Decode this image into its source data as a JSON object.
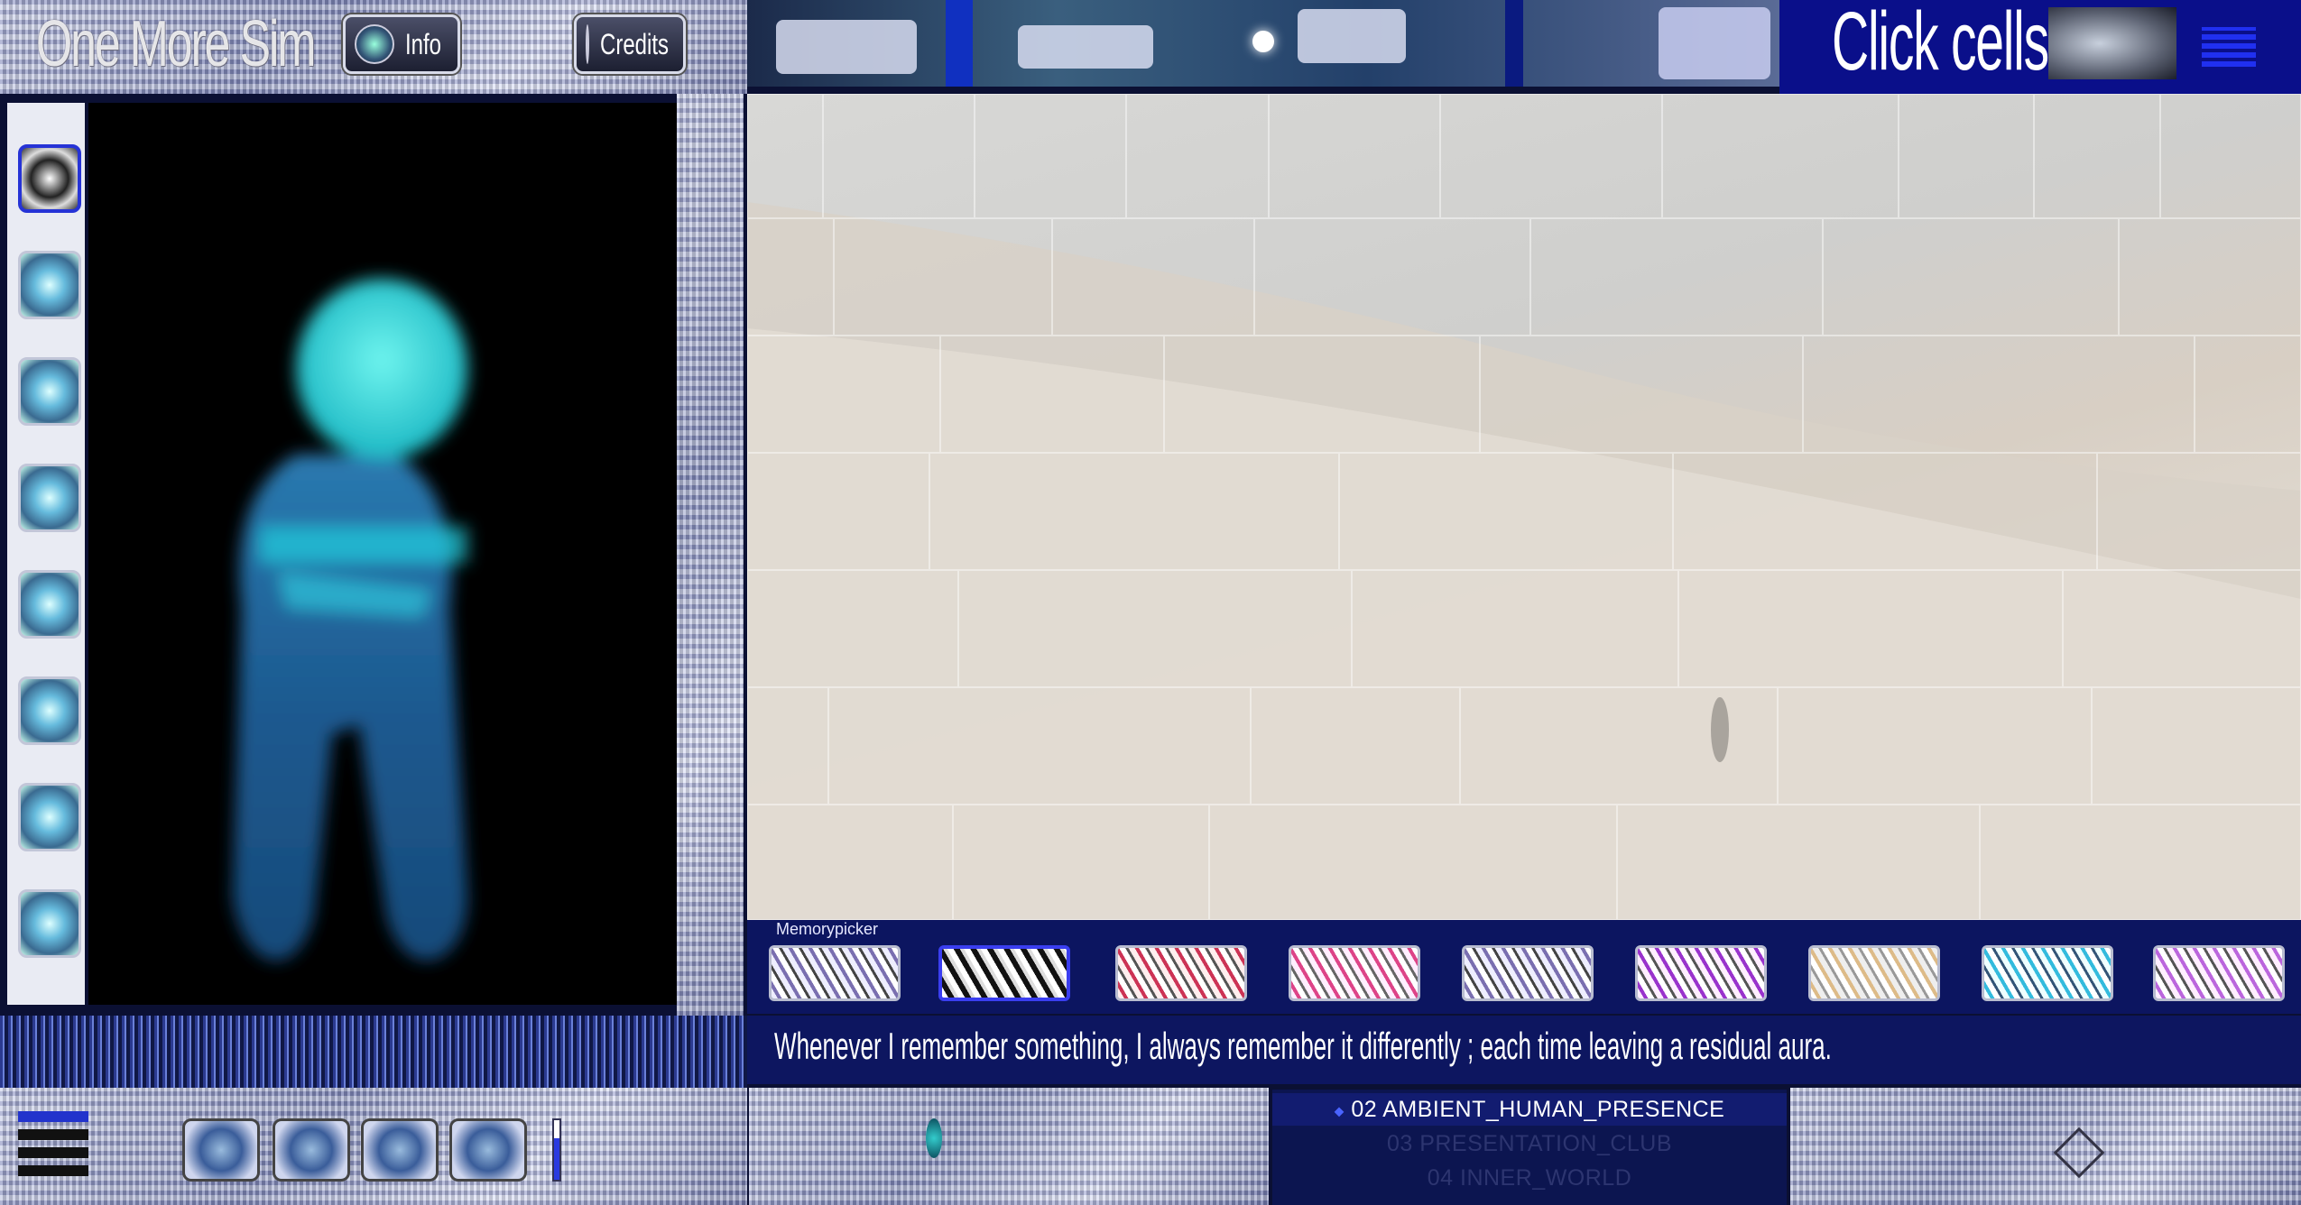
{
  "header": {
    "logo_text": "One More Sim",
    "info_label": "Info",
    "credits_label": "Credits",
    "click_cells_label": "Click cells"
  },
  "memory_picker": {
    "label": "Memorypicker",
    "thumbnail_count": 9,
    "selected_index": 1
  },
  "caption": {
    "text": "Whenever I remember something, I always remember it differently ; each time leaving a residual aura."
  },
  "playlist": {
    "tracks": [
      {
        "label": "02 AMBIENT_HUMAN_PRESENCE"
      },
      {
        "label": "03 PRESENTATION_CLUB"
      },
      {
        "label": "04 INNER_WORLD"
      }
    ],
    "current_index": 0
  },
  "sidebar": {
    "icon_count": 8,
    "selected_index": 0
  },
  "colors": {
    "panel_blue": "#0c1560",
    "accent_blue": "#2633d6",
    "avatar_cyan": "#3fe0e0"
  }
}
